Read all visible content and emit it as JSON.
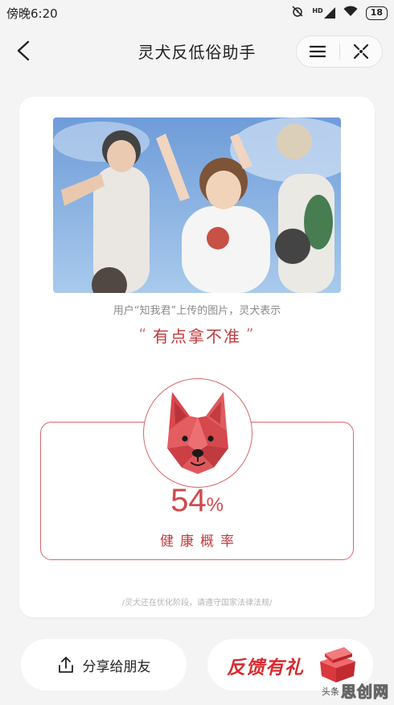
{
  "status_bar": {
    "time": "傍晚6:20",
    "hd_label": "HD",
    "battery": "18"
  },
  "nav": {
    "title": "灵犬反低俗助手"
  },
  "result": {
    "caption": "用户“知我君”上传的图片，灵犬表示",
    "quote_open": "“",
    "verdict": "有点拿不准",
    "quote_close": "”",
    "score": "54",
    "score_unit": "%",
    "metric_label": "健康概率",
    "disclaimer": "/灵犬还在优化阶段，请遵守国家法律法规/"
  },
  "actions": {
    "share_label": "分享给朋友",
    "gift_label": "反馈有礼"
  },
  "watermark": {
    "small": "头条",
    "big": "思创网"
  },
  "colors": {
    "accent": "#d04a4e",
    "brand_red": "#d92a2e",
    "background": "#f4f4f4"
  },
  "icons": {
    "back": "chevron-left-icon",
    "menu": "menu-icon",
    "close": "close-icon",
    "share": "share-icon",
    "gift": "gift-box-icon",
    "mascot": "dog-mascot-icon"
  }
}
